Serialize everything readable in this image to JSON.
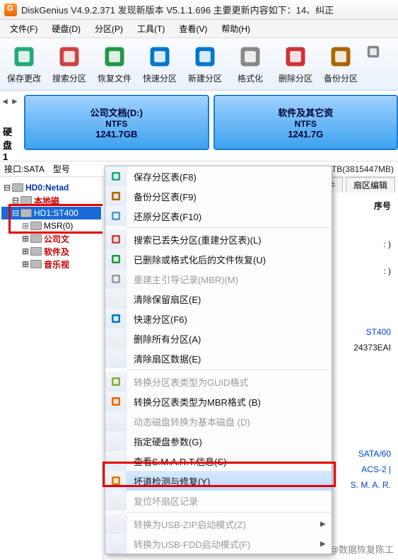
{
  "titlebar": {
    "title": "DiskGenius V4.9.2.371  发现新版本 V5.1.1.696 主要更新内容如下：14、纠正"
  },
  "menubar": [
    "文件(F)",
    "硬盘(D)",
    "分区(P)",
    "工具(T)",
    "查看(V)",
    "帮助(H)"
  ],
  "toolbar": [
    {
      "name": "save",
      "label": "保存更改"
    },
    {
      "name": "search",
      "label": "搜索分区"
    },
    {
      "name": "recover",
      "label": "恢复文件"
    },
    {
      "name": "quick",
      "label": "快速分区"
    },
    {
      "name": "new",
      "label": "新建分区"
    },
    {
      "name": "format",
      "label": "格式化"
    },
    {
      "name": "delete",
      "label": "删除分区"
    },
    {
      "name": "backup",
      "label": "备份分区"
    }
  ],
  "disk": {
    "label": "硬盘 1",
    "interface_label": "接口:SATA",
    "model_label": "型号",
    "right_info": "TB(3815447MB)"
  },
  "partitions": [
    {
      "name": "公司文档(D:)",
      "fs": "NTFS",
      "size": "1241.7GB"
    },
    {
      "name": "软件及其它资",
      "fs": "NTFS",
      "size": "1241.7G"
    }
  ],
  "tree": [
    {
      "l": 0,
      "label": "HD0:Netad",
      "cls": "blue"
    },
    {
      "l": 1,
      "label": "本地磁",
      "cls": "red"
    },
    {
      "l": 1,
      "label": "HD1:ST400",
      "cls": "sel"
    },
    {
      "l": 2,
      "label": "MSR(0)",
      "cls": ""
    },
    {
      "l": 2,
      "label": "公司文",
      "cls": "red"
    },
    {
      "l": 2,
      "label": "软件及",
      "cls": "red"
    },
    {
      "l": 2,
      "label": "音乐视",
      "cls": "red"
    }
  ],
  "tabs": [
    "件",
    "扇区编辑"
  ],
  "right_col": {
    "header": "序号",
    "a": ": )",
    "b": ": )",
    "model": "ST400",
    "cap": "24373EAI",
    "iface": "SATA/60",
    "acs": "ACS-2 |",
    "smart": "S. M. A. R."
  },
  "ctx": [
    {
      "t": "item",
      "label": "保存分区表(F8)",
      "icon": "save"
    },
    {
      "t": "item",
      "label": "备份分区表(F9)",
      "icon": "backup"
    },
    {
      "t": "item",
      "label": "还原分区表(F10)",
      "icon": "restore"
    },
    {
      "t": "sep"
    },
    {
      "t": "item",
      "label": "搜索已丢失分区(重建分区表)(L)",
      "icon": "search"
    },
    {
      "t": "item",
      "label": "已删除或格式化后的文件恢复(U)",
      "icon": "recover"
    },
    {
      "t": "item",
      "label": "重建主引导记录(MBR)(M)",
      "icon": "mbr",
      "disabled": true
    },
    {
      "t": "item",
      "label": "清除保留扇区(E)",
      "icon": ""
    },
    {
      "t": "item",
      "label": "快速分区(F6)",
      "icon": "quick"
    },
    {
      "t": "item",
      "label": "删除所有分区(A)",
      "icon": ""
    },
    {
      "t": "item",
      "label": "清除扇区数据(E)",
      "icon": ""
    },
    {
      "t": "sep"
    },
    {
      "t": "item",
      "label": "转换分区表类型为GUID格式",
      "icon": "guid",
      "disabled": true
    },
    {
      "t": "item",
      "label": "转换分区表类型为MBR格式  (B)",
      "icon": "tombr"
    },
    {
      "t": "item",
      "label": "动态磁盘转换为基本磁盘 (D)",
      "icon": "",
      "disabled": true
    },
    {
      "t": "item",
      "label": "指定硬盘参数(G)",
      "icon": ""
    },
    {
      "t": "item",
      "label": "查看S.M.A.R.T.信息(S)",
      "icon": ""
    },
    {
      "t": "item",
      "label": "坏道检测与修复(Y)",
      "icon": "repair",
      "sel": true
    },
    {
      "t": "item",
      "label": "复位坏扇区记录",
      "icon": "",
      "disabled": true
    },
    {
      "t": "sep"
    },
    {
      "t": "item",
      "label": "转换为USB-ZIP启动模式(Z)",
      "icon": "",
      "disabled": true,
      "arr": true
    },
    {
      "t": "item",
      "label": "转换为USB-FDD启动模式(F)",
      "icon": "",
      "disabled": true,
      "arr": true
    }
  ],
  "watermark": "头条 @数据恢复陈工"
}
